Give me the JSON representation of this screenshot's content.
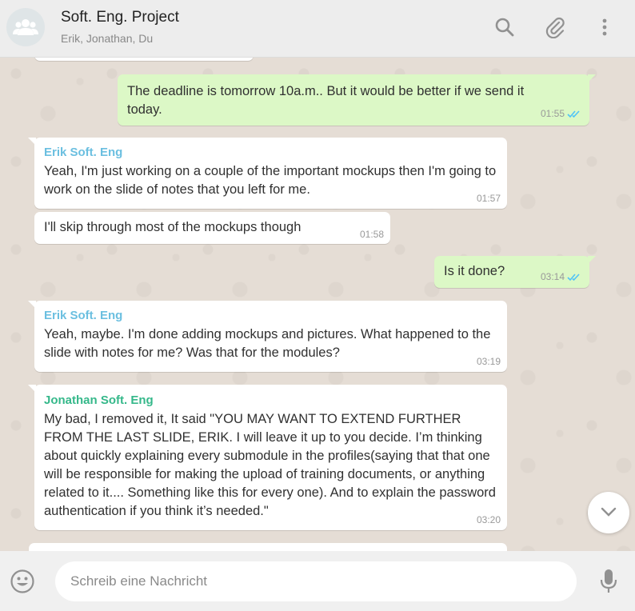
{
  "header": {
    "title": "Soft. Eng. Project",
    "subtitle": "Erik, Jonathan, Du",
    "icons": [
      "group-avatar-icon",
      "search-icon",
      "attach-icon",
      "menu-icon"
    ]
  },
  "messages": [
    {
      "direction": "out",
      "text": "The deadline is tomorrow 10a.m.. But it would be better if we send it today.",
      "time": "01:55",
      "status": "read"
    },
    {
      "direction": "in",
      "sender": "Erik Soft. Eng",
      "text": "Yeah, I'm just working on a couple of the important mockups then I'm going to work on the slide of notes that you left for me.",
      "time": "01:57"
    },
    {
      "direction": "in",
      "text": "I'll skip through most of the mockups though",
      "time": "01:58"
    },
    {
      "direction": "out",
      "text": "Is it done?",
      "time": "03:14",
      "status": "read"
    },
    {
      "direction": "in",
      "sender": "Erik Soft. Eng",
      "text": "Yeah, maybe. I'm done adding mockups and pictures. What happened to the slide with notes for me? Was that for the modules?",
      "time": "03:19"
    },
    {
      "direction": "in",
      "sender": "Jonathan Soft. Eng",
      "text": "My bad, I removed it, It said \"YOU MAY WANT TO EXTEND FURTHER FROM THE LAST SLIDE, ERIK. I will leave it up to you decide. I’m thinking about quickly explaining every submodule in the profiles(saying that that one will be responsible for making the upload of training documents, or anything related to it....  Something like this for every one). And to explain the password authentication if you think it’s needed.\"",
      "time": "03:20"
    }
  ],
  "composer": {
    "placeholder": "Schreib eine Nachricht",
    "value": ""
  },
  "colors": {
    "outgoing_bubble": "#dcf8c6",
    "incoming_bubble": "#ffffff",
    "erik_name": "#6bbfe0",
    "jonathan_name": "#35b88a",
    "read_ticks": "#4fc3f7",
    "chat_background": "#e5ddd5"
  }
}
